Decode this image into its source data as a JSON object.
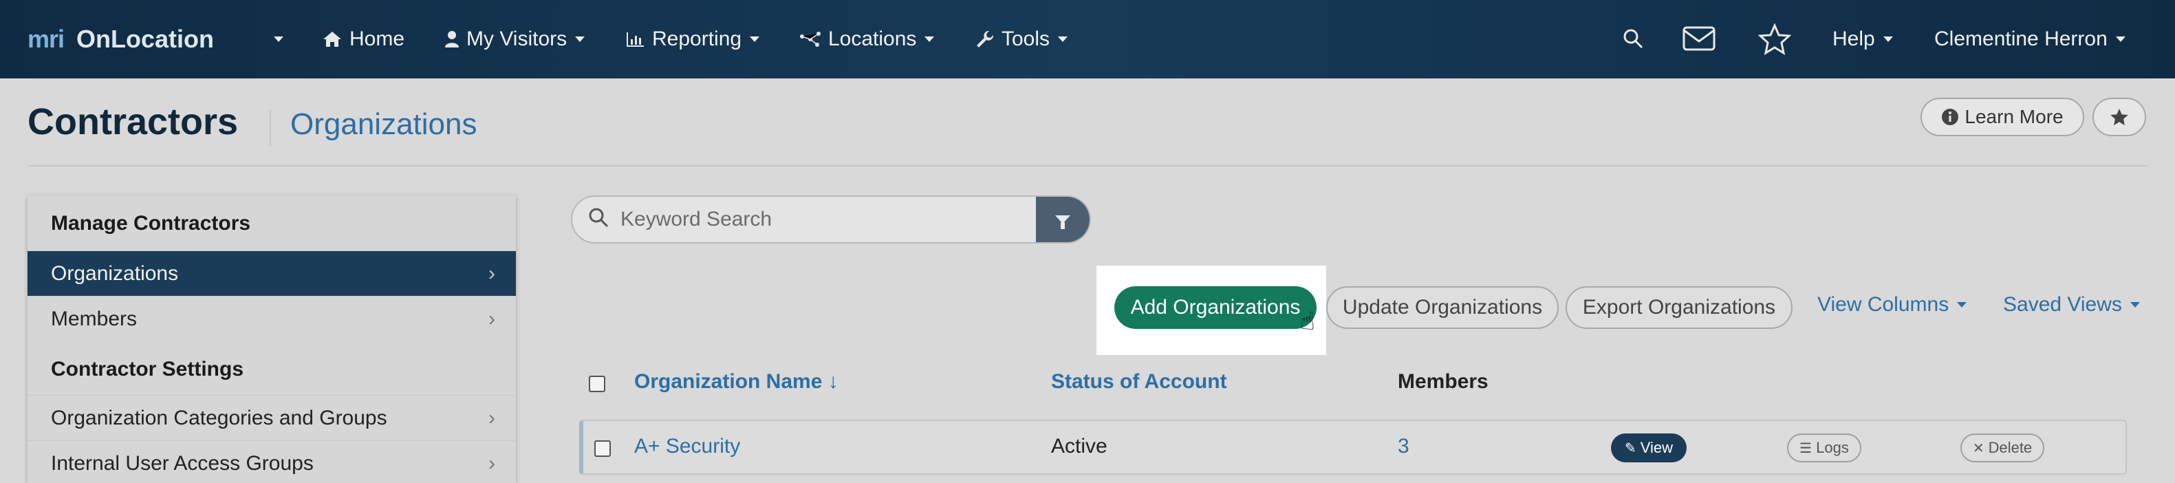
{
  "nav": {
    "brand_mark": "mri",
    "brand_name": "OnLocation",
    "items": [
      {
        "label": "Home",
        "icon": "home-icon"
      },
      {
        "label": "My Visitors",
        "icon": "person-icon"
      },
      {
        "label": "Reporting",
        "icon": "chart-icon"
      },
      {
        "label": "Locations",
        "icon": "network-icon"
      },
      {
        "label": "Tools",
        "icon": "wrench-icon"
      }
    ],
    "help": "Help",
    "user": "Clementine Herron"
  },
  "header": {
    "title": "Contractors",
    "subtitle": "Organizations",
    "learn_more": "Learn More"
  },
  "sidebar": {
    "section1": "Manage Contractors",
    "items1": [
      {
        "label": "Organizations",
        "active": true
      },
      {
        "label": "Members",
        "active": false
      }
    ],
    "section2": "Contractor Settings",
    "items2": [
      {
        "label": "Organization Categories and Groups"
      },
      {
        "label": "Internal User Access Groups"
      }
    ]
  },
  "search": {
    "placeholder": "Keyword Search"
  },
  "toolbar": {
    "add": "Add Organizations",
    "update": "Update Organizations",
    "export": "Export Organizations",
    "view_columns": "View Columns",
    "saved_views": "Saved Views"
  },
  "table": {
    "columns": [
      "Organization Name ↓",
      "Status of Account",
      "Members"
    ],
    "rows": [
      {
        "name": "A+ Security",
        "status": "Active",
        "members": "3",
        "view": "View",
        "logs": "Logs",
        "delete": "Delete"
      }
    ]
  },
  "colors": {
    "nav_bg": "#0f2b44",
    "accent_link": "#2d6ea6",
    "primary_button": "#137a5a",
    "sidebar_active": "#1b3c58"
  }
}
